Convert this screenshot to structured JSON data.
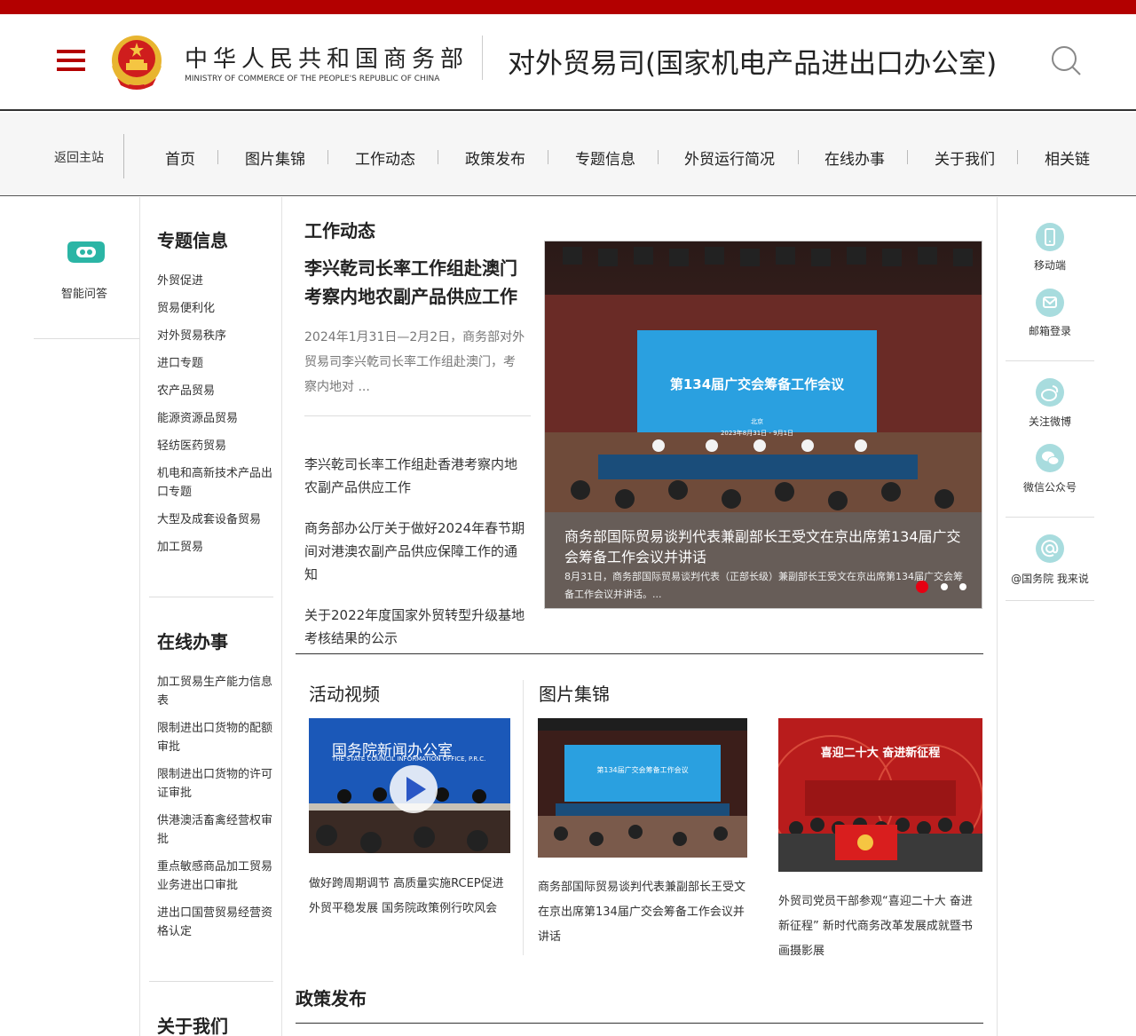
{
  "header": {
    "ministry_cn": "中华人民共和国商务部",
    "ministry_en": "MINISTRY OF COMMERCE OF THE PEOPLE'S REPUBLIC OF CHINA",
    "dept_title": "对外贸易司(国家机电产品进出口办公室)"
  },
  "nav": {
    "back": "返回主站",
    "items": [
      "首页",
      "图片集锦",
      "工作动态",
      "政策发布",
      "专题信息",
      "外贸运行简况",
      "在线办事",
      "关于我们",
      "相关链"
    ]
  },
  "left_rail": {
    "assistant_label": "智能问答"
  },
  "side_menu": {
    "topics_heading": "专题信息",
    "topics": [
      "外贸促进",
      "贸易便利化",
      "对外贸易秩序",
      "进口专题",
      "农产品贸易",
      "能源资源品贸易",
      "轻纺医药贸易",
      "机电和高新技术产品出口专题",
      "大型及成套设备贸易",
      "加工贸易"
    ],
    "online_heading": "在线办事",
    "online": [
      "加工贸易生产能力信息表",
      "限制进出口货物的配额审批",
      "限制进出口货物的许可证审批",
      "供港澳活畜禽经营权审批",
      "重点敏感商品加工贸易业务进出口审批",
      "进出口国营贸易经营资格认定"
    ],
    "about_heading": "关于我们"
  },
  "work_news": {
    "title": "工作动态",
    "headline": "李兴乾司长率工作组赴澳门考察内地农副产品供应工作",
    "summary": "2024年1月31日—2月2日，商务部对外贸易司李兴乾司长率工作组赴澳门，考察内地对 ...",
    "items": [
      "李兴乾司长率工作组赴香港考察内地农副产品供应工作",
      "商务部办公厅关于做好2024年春节期间对港澳农副产品供应保障工作的通知",
      "关于2022年度国家外贸转型升级基地考核结果的公示"
    ]
  },
  "slider": {
    "screen_text": "第134届广交会筹备工作会议",
    "screen_sub1": "北京",
    "screen_sub2": "2023年8月31日 - 9月1日",
    "title": "商务部国际贸易谈判代表兼副部长王受文在京出席第134届广交会筹备工作会议并讲话",
    "desc": "8月31日，商务部国际贸易谈判代表（正部长级）兼副部长王受文在京出席第134届广交会筹备工作会议并讲话。...",
    "active_dot": 1,
    "dot_count": 3
  },
  "videos": {
    "title": "活动视频",
    "thumb_title_cn": "国务院新闻办公室",
    "thumb_title_en": "THE STATE COUNCIL INFORMATION OFFICE, P.R.C.",
    "caption": "做好跨周期调节 高质量实施RCEP促进外贸平稳发展 国务院政策例行吹风会"
  },
  "gallery": {
    "title": "图片集锦",
    "photo1_screen": "第134届广交会筹备工作会议",
    "photo1_caption": "商务部国际贸易谈判代表兼副部长王受文在京出席第134届广交会筹备工作会议并讲话",
    "photo2_banner": "喜迎二十大 奋进新征程",
    "photo2_caption": "外贸司党员干部参观“喜迎二十大 奋进新征程” 新时代商务改革发展成就暨书画摄影展"
  },
  "policy": {
    "title": "政策发布"
  },
  "right_rail": {
    "mobile": "移动端",
    "mail": "邮箱登录",
    "weibo": "关注微博",
    "wechat": "微信公众号",
    "state_council": "@国务院 我来说"
  },
  "colors": {
    "brand_red": "#b30000",
    "accent_teal": "#a8dcde",
    "robot_teal": "#2bb5a5"
  }
}
